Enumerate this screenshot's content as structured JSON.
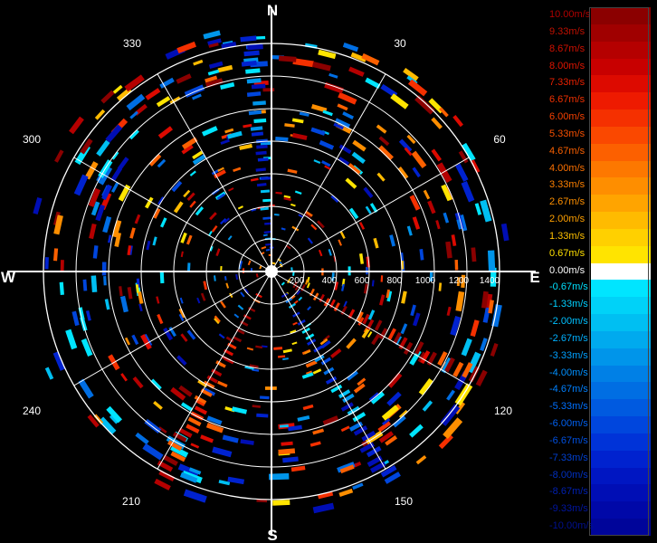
{
  "compass": {
    "north": "N",
    "south": "S",
    "east": "E",
    "west": "W"
  },
  "angle_labels": [
    "30",
    "60",
    "120",
    "150",
    "210",
    "240",
    "300",
    "330"
  ],
  "range_labels": [
    "200",
    "400",
    "600",
    "800",
    "1000",
    "1200",
    "1400"
  ],
  "scale": {
    "labels": [
      "10.00m/s",
      "9.33m/s",
      "8.67m/s",
      "8.00m/s",
      "7.33m/s",
      "6.67m/s",
      "6.00m/s",
      "5.33m/s",
      "4.67m/s",
      "4.00m/s",
      "3.33m/s",
      "2.67m/s",
      "2.00m/s",
      "1.33m/s",
      "0.67m/s",
      "0.00m/s",
      "-0.67m/s",
      "-1.33m/s",
      "-2.00m/s",
      "-2.67m/s",
      "-3.33m/s",
      "-4.00m/s",
      "-4.67m/s",
      "-5.33m/s",
      "-6.00m/s",
      "-6.67m/s",
      "-7.33m/s",
      "-8.00m/s",
      "-8.67m/s",
      "-9.33m/s",
      "-10.00m/s"
    ],
    "colors": [
      "#8b0000",
      "#a00000",
      "#b50000",
      "#c80000",
      "#dd0a00",
      "#ee1a00",
      "#f53000",
      "#fa4800",
      "#fc6000",
      "#fd7800",
      "#fe8e00",
      "#ffa400",
      "#ffbb00",
      "#ffd000",
      "#ffe400",
      "#ffffff",
      "#00e5ff",
      "#00d2f8",
      "#00bff2",
      "#00aaee",
      "#0095ea",
      "#0080e6",
      "#006ee3",
      "#005ae0",
      "#0046dd",
      "#0033d8",
      "#0022cf",
      "#0016c2",
      "#000eb5",
      "#0008a8",
      "#00059a"
    ],
    "label_colors": [
      "#b00000",
      "#c01000",
      "#d01000",
      "#e01500",
      "#e82000",
      "#f03000",
      "#f54000",
      "#f85000",
      "#fa6000",
      "#fc7000",
      "#fd8000",
      "#fe9000",
      "#ffa000",
      "#ffc000",
      "#ffe000",
      "#ffffff",
      "#00e0ff",
      "#00d0ff",
      "#00c0ff",
      "#00b0ff",
      "#00a0ff",
      "#0090ff",
      "#0080ff",
      "#0070ff",
      "#0060f0",
      "#0050e0",
      "#0040d0",
      "#0030c0",
      "#0020b0",
      "#0015a0",
      "#001090"
    ]
  }
}
